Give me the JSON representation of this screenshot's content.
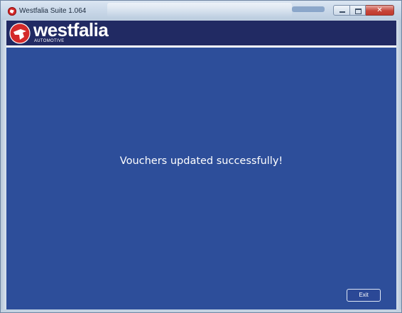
{
  "window": {
    "title": "Westfalia Suite 1.064"
  },
  "brand": {
    "name": "westfalia",
    "subtitle": "AUTOMOTIVE",
    "logo_icon": "westfalia-logo-icon"
  },
  "main": {
    "message": "Vouchers updated successfully!"
  },
  "actions": {
    "exit_label": "Exit"
  },
  "window_controls": {
    "minimize_icon": "minimize-icon",
    "maximize_icon": "maximize-icon",
    "close_icon": "close-icon",
    "close_glyph": "✕"
  },
  "colors": {
    "content_background": "#2d4e9a",
    "brand_band": "#212a63",
    "logo_red": "#d42a2a",
    "text": "#ffffff"
  }
}
